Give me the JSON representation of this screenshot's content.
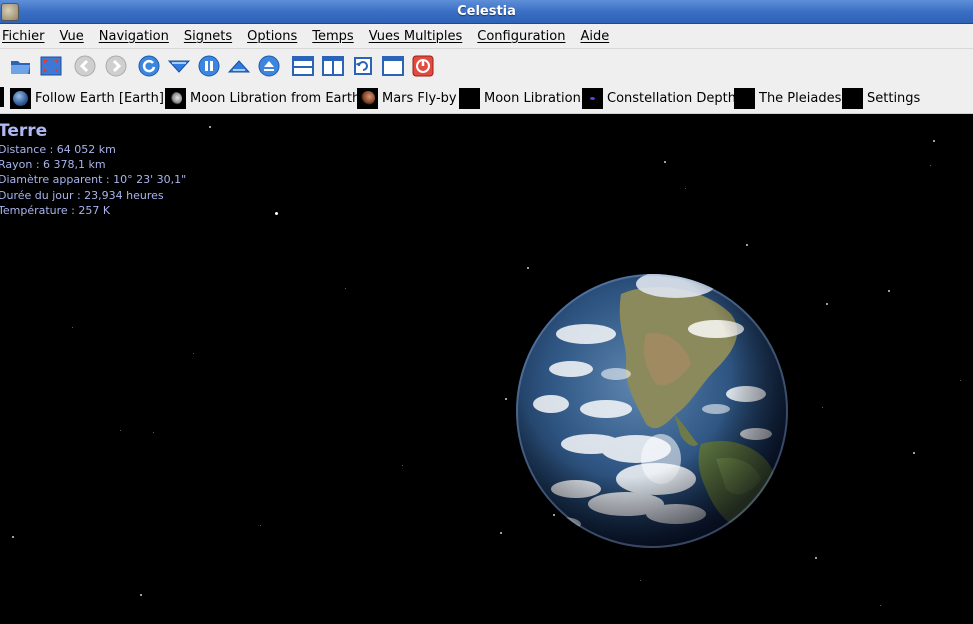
{
  "window": {
    "title": "Celestia"
  },
  "menubar": {
    "items": [
      "Fichier",
      "Vue",
      "Navigation",
      "Signets",
      "Options",
      "Temps",
      "Vues Multiples",
      "Configuration",
      "Aide"
    ]
  },
  "toolbar": {
    "buttons": [
      "open-folder-icon",
      "fullscreen-icon",
      "back-icon",
      "forward-icon",
      "refresh-icon",
      "slower-icon",
      "pause-icon",
      "faster-icon",
      "eject-icon",
      "split-horizontal-icon",
      "split-vertical-icon",
      "cycle-view-icon",
      "single-view-icon",
      "stop-icon"
    ]
  },
  "bookmarks": {
    "items": [
      {
        "label": "Follow Earth [Earth]",
        "thumb": "earth-thumb-icon"
      },
      {
        "label": "Moon Libration from Earth",
        "thumb": "moon-thumb-icon"
      },
      {
        "label": "Mars Fly-by",
        "thumb": "mars-thumb-icon"
      },
      {
        "label": "Moon Libration",
        "thumb": "dark-thumb-icon"
      },
      {
        "label": "Constellation Depth",
        "thumb": "constellation-thumb-icon"
      },
      {
        "label": "The Pleiades",
        "thumb": "dark-thumb-icon"
      },
      {
        "label": "Settings",
        "thumb": "dark-thumb-icon"
      }
    ]
  },
  "info": {
    "name": "Terre",
    "distance": "Distance : 64 052 km",
    "rayon": "Rayon : 6 378,1 km",
    "diametre": "Diamètre apparent : 10° 23' 30,1\"",
    "duree": "Durée du jour : 23,934 heures",
    "temperature": "Température : 257 K"
  },
  "colors": {
    "titlebar": "#3a6fc4",
    "menubar_bg": "#efefef",
    "info_text": "#a9b4ee",
    "space": "#000000"
  }
}
